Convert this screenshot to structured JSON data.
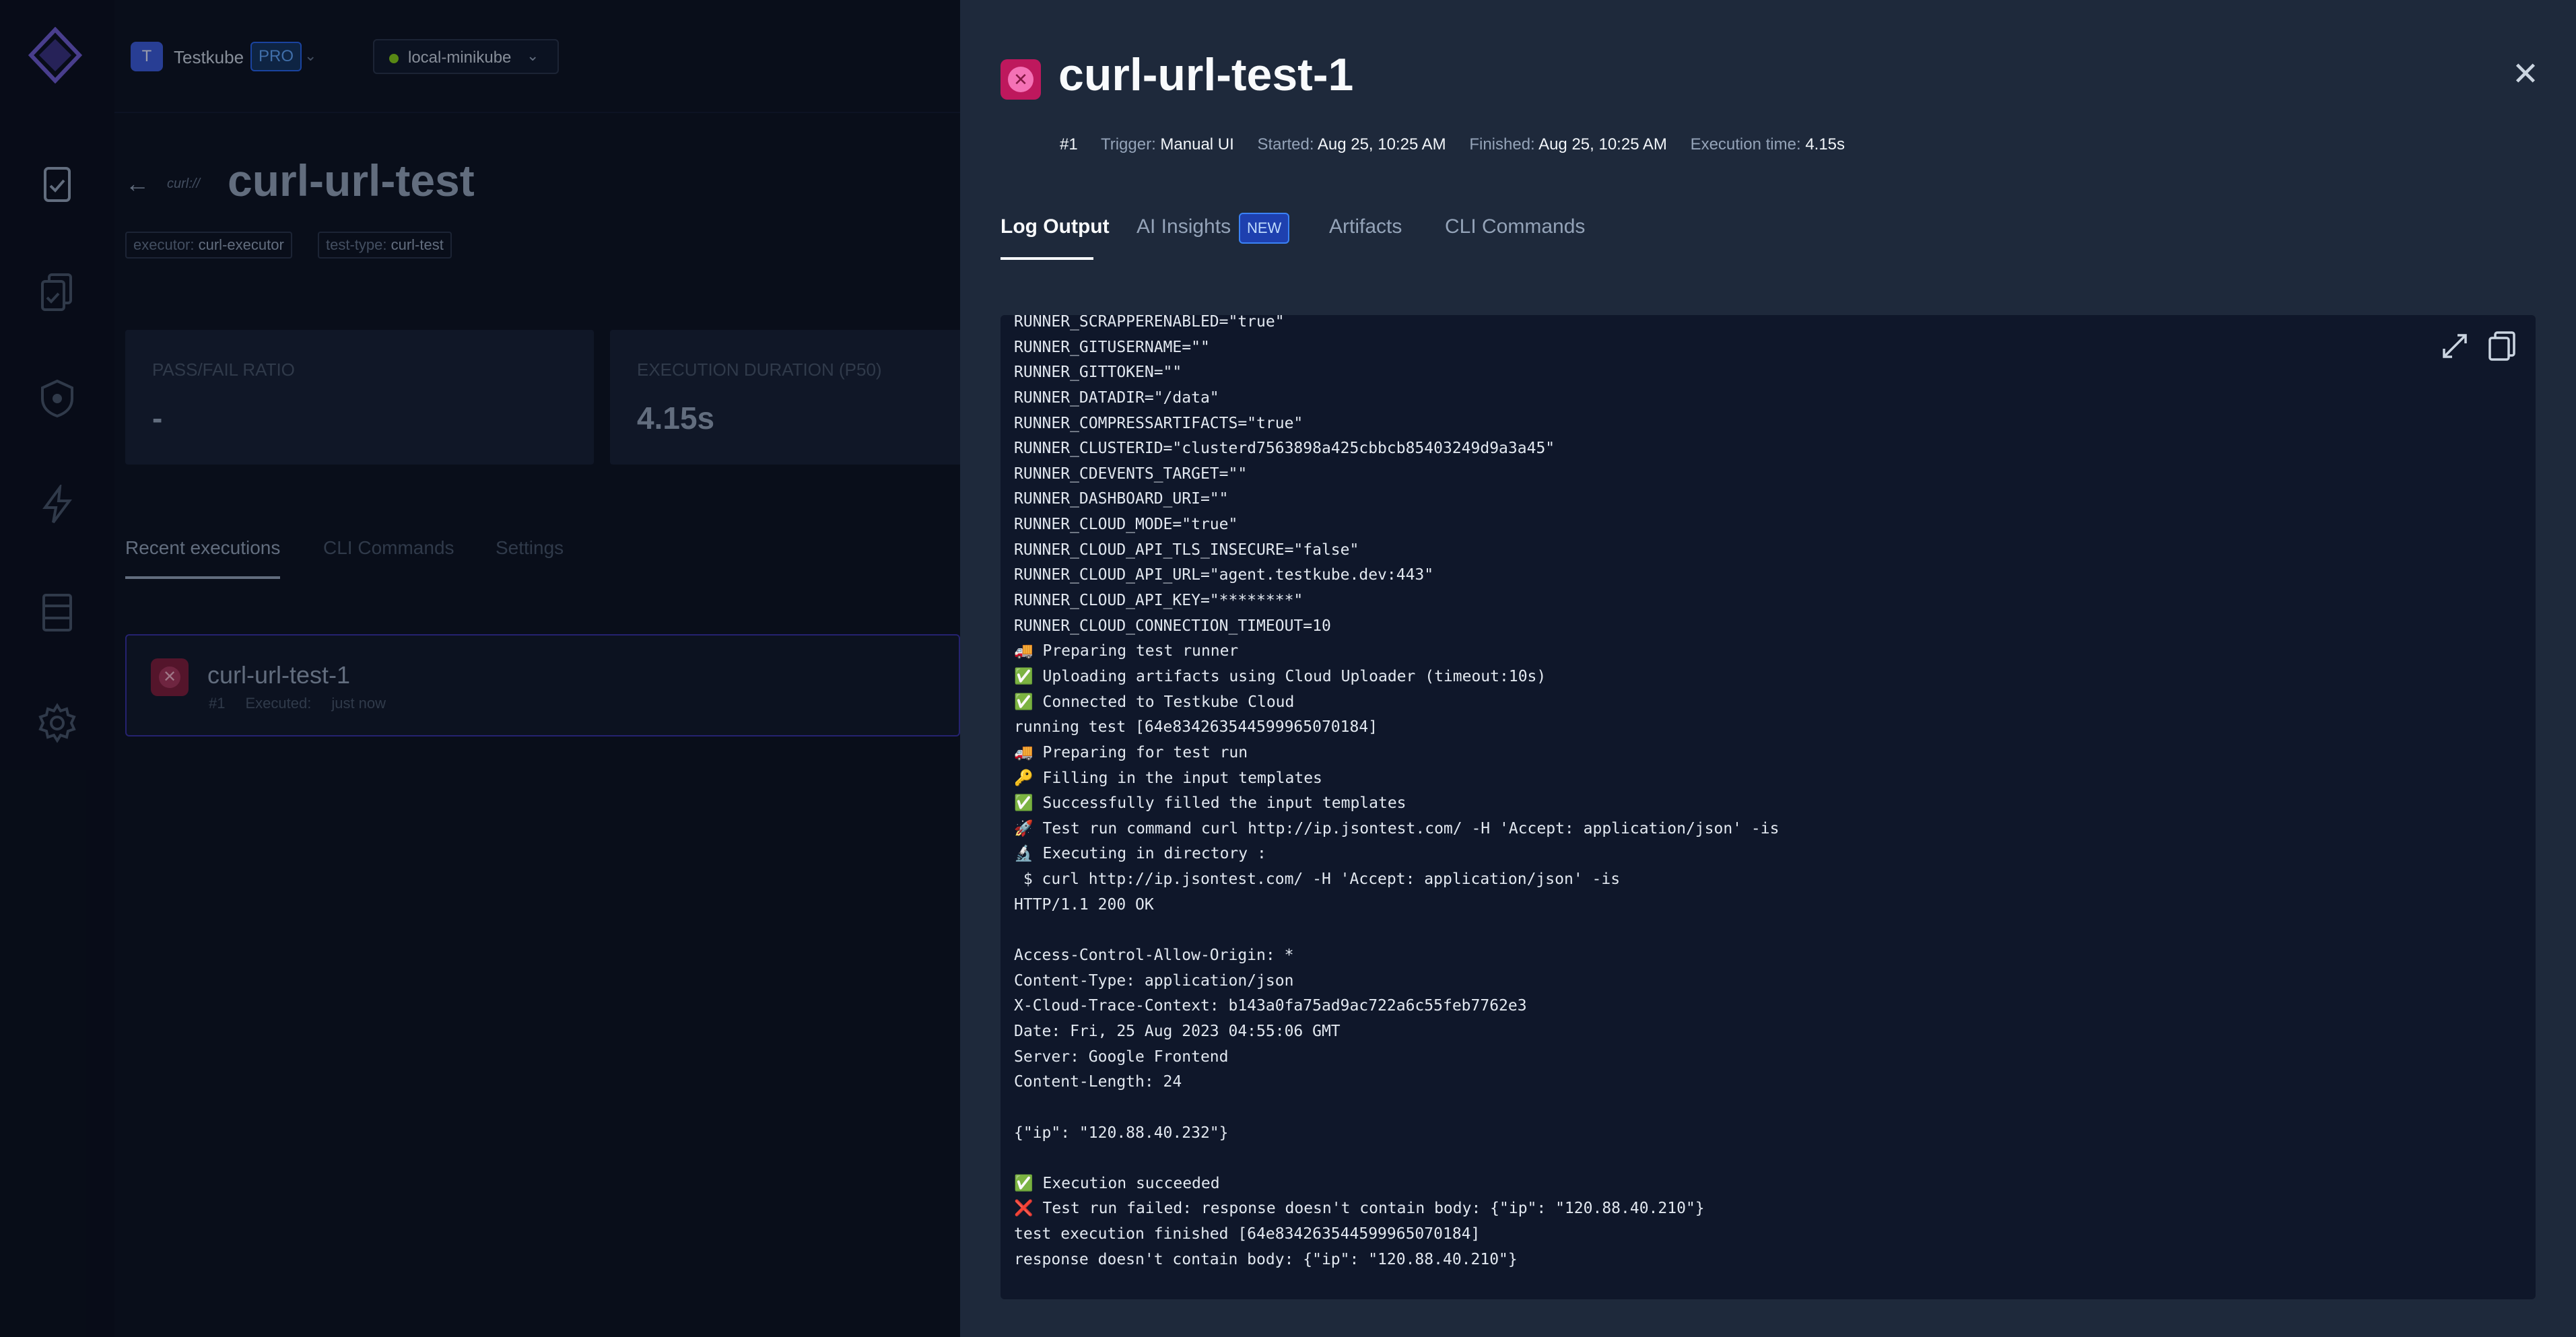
{
  "org": {
    "initial": "T",
    "name": "Testkube",
    "plan": "PRO"
  },
  "environment": {
    "name": "local-minikube"
  },
  "test": {
    "logo_text": "curl://",
    "title": "curl-url-test",
    "tags": [
      {
        "key": "executor:",
        "value": "curl-executor"
      },
      {
        "key": "test-type:",
        "value": "curl-test"
      }
    ]
  },
  "stats": [
    {
      "label": "PASS/FAIL RATIO",
      "value": "-"
    },
    {
      "label": "EXECUTION DURATION (P50)",
      "value": "4.15s"
    }
  ],
  "test_tabs": [
    "Recent executions",
    "CLI Commands",
    "Settings"
  ],
  "executions": [
    {
      "name": "curl-url-test-1",
      "number": "#1",
      "executed_label": "Executed:",
      "executed_value": "just now"
    }
  ],
  "drawer": {
    "title": "curl-url-test-1",
    "run_number": "#1",
    "meta": {
      "trigger_label": "Trigger:",
      "trigger_value": "Manual UI",
      "started_label": "Started:",
      "started_value": "Aug 25, 10:25 AM",
      "finished_label": "Finished:",
      "finished_value": "Aug 25, 10:25 AM",
      "exec_time_label": "Execution time:",
      "exec_time_value": "4.15s"
    },
    "tabs": [
      "Log Output",
      "AI Insights",
      "Artifacts",
      "CLI Commands"
    ],
    "new_badge": "NEW",
    "log_lines": [
      "RUNNER_SCRAPPERENABLED=\"true\"",
      "RUNNER_GITUSERNAME=\"\"",
      "RUNNER_GITTOKEN=\"\"",
      "RUNNER_DATADIR=\"/data\"",
      "RUNNER_COMPRESSARTIFACTS=\"true\"",
      "RUNNER_CLUSTERID=\"clusterd7563898a425cbbcb85403249d9a3a45\"",
      "RUNNER_CDEVENTS_TARGET=\"\"",
      "RUNNER_DASHBOARD_URI=\"\"",
      "RUNNER_CLOUD_MODE=\"true\"",
      "RUNNER_CLOUD_API_TLS_INSECURE=\"false\"",
      "RUNNER_CLOUD_API_URL=\"agent.testkube.dev:443\"",
      "RUNNER_CLOUD_API_KEY=\"********\"",
      "RUNNER_CLOUD_CONNECTION_TIMEOUT=10",
      "🚚 Preparing test runner",
      "✅ Uploading artifacts using Cloud Uploader (timeout:10s)",
      "✅ Connected to Testkube Cloud",
      "running test [64e834263544599965070184]",
      "🚚 Preparing for test run",
      "🔑 Filling in the input templates",
      "✅ Successfully filled the input templates",
      "🚀 Test run command curl http://ip.jsontest.com/ -H 'Accept: application/json' -is",
      "🔬 Executing in directory :",
      " $ curl http://ip.jsontest.com/ -H 'Accept: application/json' -is",
      "HTTP/1.1 200 OK",
      "",
      "Access-Control-Allow-Origin: *",
      "Content-Type: application/json",
      "X-Cloud-Trace-Context: b143a0fa75ad9ac722a6c55feb7762e3",
      "Date: Fri, 25 Aug 2023 04:55:06 GMT",
      "Server: Google Frontend",
      "Content-Length: 24",
      "",
      "{\"ip\": \"120.88.40.232\"}",
      "",
      "✅ Execution succeeded",
      "❌ Test run failed: response doesn't contain body: {\"ip\": \"120.88.40.210\"}",
      "test execution finished [64e834263544599965070184]",
      "response doesn't contain body: {\"ip\": \"120.88.40.210\"}"
    ]
  }
}
